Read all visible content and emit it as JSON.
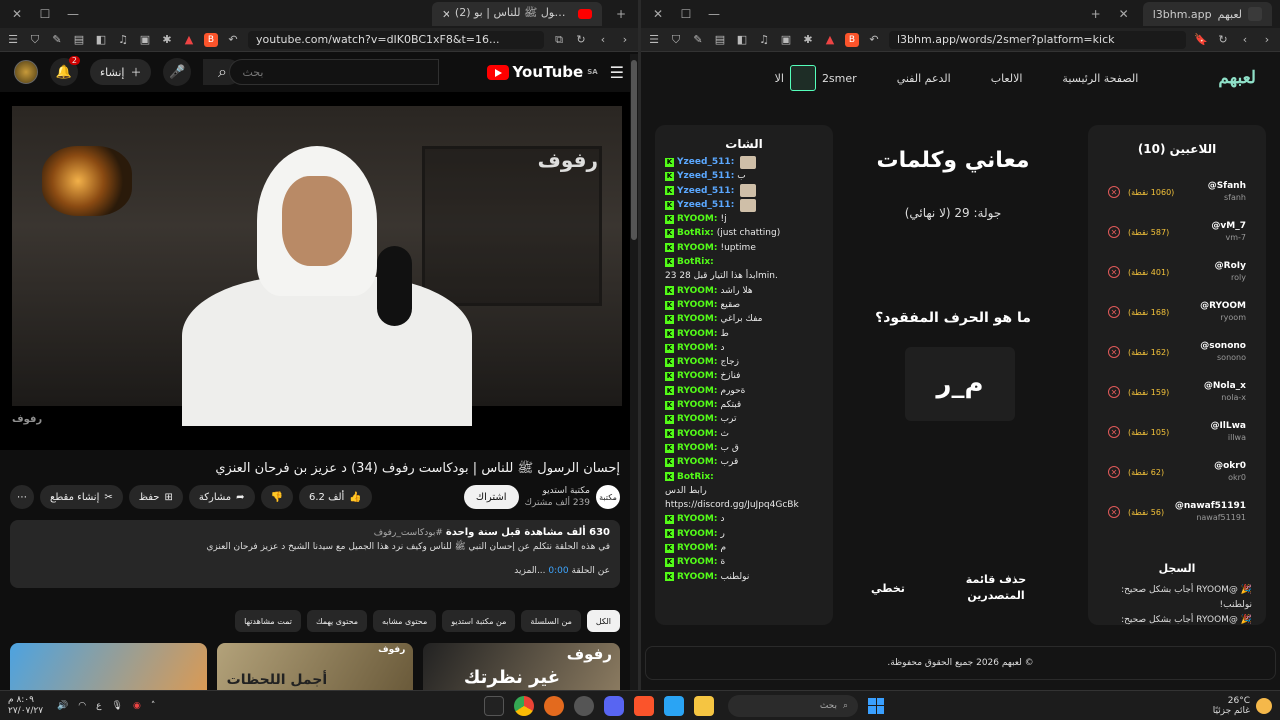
{
  "left_window": {
    "tab_title": "(2) إحسان الرسول ﷺ للناس | بو",
    "url": "youtube.com/watch?v=dIK0BC1xF8&t=16...",
    "youtube": {
      "logo": "YouTube",
      "region": "SA",
      "search_placeholder": "بحث",
      "create_label": "إنشاء",
      "notif_count": "2",
      "video_watermark": "رفوف",
      "video_watermark_small": "رفوف",
      "video_title": "إحسان الرسول ﷺ للناس | بودكاست رفوف (34) د عزيز بن فرحان العنزي",
      "channel_name": "مكتبة استديو",
      "channel_subs": "239 ألف مشترك",
      "channel_avatar_text": "مكتبة",
      "subscribe_label": "اشتراك",
      "likes": "6.2 ألف",
      "share_label": "مشاركة",
      "save_label": "حفظ",
      "clip_label": "إنشاء مقطع",
      "more_icon": "⋯",
      "desc_stats": "630 ألف مشاهدة  قبل سنة واحدة",
      "desc_tag": "#بودكاست_رفوف",
      "desc_body": "في هذه الحلقة نتكلم عن إحسان النبي ﷺ للناس وكيف نرد هذا الجميل مع سيدنا الشيخ د عزيز فرحان العنزي",
      "desc_episode": "عن الحلقة",
      "desc_time": "0:00",
      "desc_more": "...المزيد",
      "chips": [
        "الكل",
        "من السلسلة",
        "من مكتبة استديو",
        "محتوى مشابه",
        "محتوى يهمك",
        "تمت مشاهدتها"
      ],
      "thumb_texts": [
        "",
        "أجمل اللحظات",
        "غير نظرتك"
      ],
      "thumb_corner": [
        "",
        "رفوف",
        "رفوف"
      ]
    }
  },
  "right_window": {
    "tab_title": "لعبهم",
    "tab_title2": "l3bhm.app",
    "url": "l3bhm.app/words/2smer?platform=kick",
    "nav": {
      "brand": "لعبهم",
      "home": "الصفحة الرئيسية",
      "games": "الالعاب",
      "support": "الدعم الفني",
      "user": "2smer",
      "cut": "الا"
    },
    "players_title": "اللاعبين (10)",
    "players": [
      {
        "name": "@Sfanh",
        "handle": "sfanh",
        "points": "(1060 نقطة)"
      },
      {
        "name": "@vM_7",
        "handle": "vm-7",
        "points": "(587 نقطة)"
      },
      {
        "name": "@RoIy",
        "handle": "roly",
        "points": "(401 نقطة)"
      },
      {
        "name": "@RYOOM",
        "handle": "ryoom",
        "points": "(168 نقطة)"
      },
      {
        "name": "@sonono",
        "handle": "sonono",
        "points": "(162 نقطة)"
      },
      {
        "name": "@Nola_x",
        "handle": "nola-x",
        "points": "(159 نقطة)"
      },
      {
        "name": "@IlLwa",
        "handle": "illwa",
        "points": "(105 نقطة)"
      },
      {
        "name": "@okr0",
        "handle": "okr0",
        "points": "(62 نقطة)"
      },
      {
        "name": "@nawaf51191",
        "handle": "nawaf51191",
        "points": "(56 نقطة)"
      }
    ],
    "log_title": "السجل",
    "log": [
      "🎉 @RYOOM أجاب بشكل صحيح: نولطنب!",
      "🎉 @RYOOM أجاب بشكل صحيح:"
    ],
    "game_title": "معاني وكلمات",
    "round": "جولة: 29 (لا نهائي)",
    "question": "ما هو الحرف المفقود؟",
    "word": "م_ر",
    "btn_remove": "حذف قائمة المتصدرين",
    "btn_skip": "تخطي",
    "chat_title": "الشات",
    "chat": [
      {
        "user": "Yzeed_511:",
        "text": "",
        "blue": true,
        "emote": true
      },
      {
        "user": "Yzeed_511:",
        "text": "ب",
        "blue": true,
        "emote": false
      },
      {
        "user": "Yzeed_511:",
        "text": "",
        "blue": true,
        "emote": true
      },
      {
        "user": "Yzeed_511:",
        "text": "",
        "blue": true,
        "emote": true
      },
      {
        "user": "RYOOM:",
        "text": "!j",
        "blue": false,
        "emote": false
      },
      {
        "user": "BotRix:",
        "text": "(just chatting)",
        "blue": false,
        "emote": false
      },
      {
        "user": "RYOOM:",
        "text": "!uptime",
        "blue": false,
        "emote": false
      },
      {
        "user": "BotRix:",
        "text": "",
        "blue": false,
        "emote": false
      },
      {
        "user": "",
        "text": "23 ابدأ هذا التيار قبل 28min.",
        "blue": false,
        "emote": false
      },
      {
        "user": "RYOOM:",
        "text": "هلا راشد",
        "blue": false,
        "emote": false
      },
      {
        "user": "RYOOM:",
        "text": "صقيع",
        "blue": false,
        "emote": false
      },
      {
        "user": "RYOOM:",
        "text": "مفك براغي",
        "blue": false,
        "emote": false
      },
      {
        "user": "RYOOM:",
        "text": "ط",
        "blue": false,
        "emote": false
      },
      {
        "user": "RYOOM:",
        "text": "د",
        "blue": false,
        "emote": false
      },
      {
        "user": "RYOOM:",
        "text": "زجاج",
        "blue": false,
        "emote": false
      },
      {
        "user": "RYOOM:",
        "text": "فنازخ",
        "blue": false,
        "emote": false
      },
      {
        "user": "RYOOM:",
        "text": "ةحورم",
        "blue": false,
        "emote": false
      },
      {
        "user": "RYOOM:",
        "text": "قبتكم",
        "blue": false,
        "emote": false
      },
      {
        "user": "RYOOM:",
        "text": "ترب",
        "blue": false,
        "emote": false
      },
      {
        "user": "RYOOM:",
        "text": "ث",
        "blue": false,
        "emote": false
      },
      {
        "user": "RYOOM:",
        "text": "ق ب",
        "blue": false,
        "emote": false
      },
      {
        "user": "RYOOM:",
        "text": "قرب",
        "blue": false,
        "emote": false
      },
      {
        "user": "BotRix:",
        "text": "",
        "blue": false,
        "emote": false
      },
      {
        "user": "",
        "text": "رابط الدس",
        "blue": false,
        "emote": false
      },
      {
        "user": "",
        "text": "https://discord.gg/JuJpq4GcBk",
        "blue": false,
        "emote": false
      },
      {
        "user": "RYOOM:",
        "text": "د",
        "blue": false,
        "emote": false
      },
      {
        "user": "RYOOM:",
        "text": "ر",
        "blue": false,
        "emote": false
      },
      {
        "user": "RYOOM:",
        "text": "م",
        "blue": false,
        "emote": false
      },
      {
        "user": "RYOOM:",
        "text": "ة",
        "blue": false,
        "emote": false
      },
      {
        "user": "RYOOM:",
        "text": "نولطنب",
        "blue": false,
        "emote": false
      }
    ],
    "footer": "© لعبهم 2026 جميع الحقوق محفوظة."
  },
  "taskbar": {
    "temp": "26°C",
    "weather_text": "غائم جزئيًا",
    "search_placeholder": "بحث",
    "lang": "ع",
    "time": "٨:٠٩ م",
    "date": "٢٧/٠٧/٢٧"
  },
  "colors": {
    "kick_green": "#53fc18",
    "yt_red": "#ff0000",
    "points_gold": "#f3c23a",
    "brand_teal": "#8fe0c8"
  }
}
